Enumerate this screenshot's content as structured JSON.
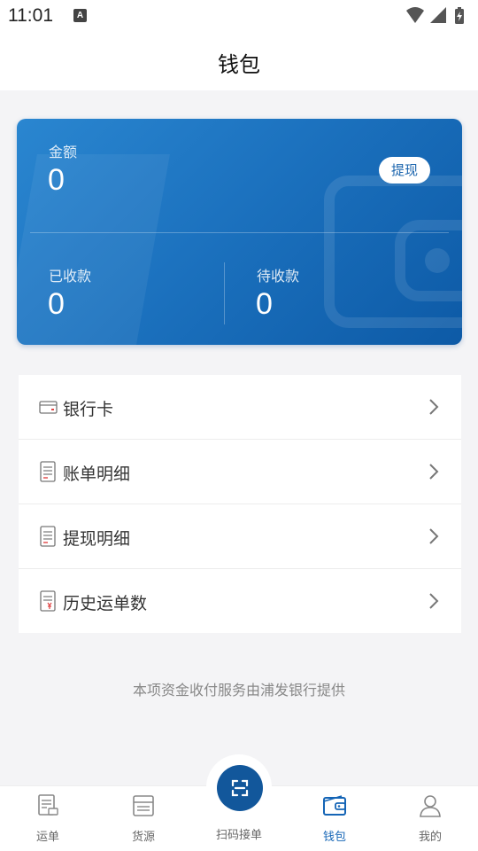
{
  "status_bar": {
    "time": "11:01",
    "notification_icon_letter": "A",
    "icons": [
      "wifi-icon",
      "signal-icon",
      "battery-charging-icon"
    ]
  },
  "header": {
    "title": "钱包"
  },
  "wallet_card": {
    "balance_label": "金额",
    "balance_value": "0",
    "withdraw_label": "提现",
    "received_label": "已收款",
    "received_value": "0",
    "pending_label": "待收款",
    "pending_value": "0",
    "gradient_colors": [
      "#2a86d0",
      "#0d5aa6"
    ]
  },
  "menu": {
    "items": [
      {
        "label": "银行卡",
        "icon": "bank-card-icon"
      },
      {
        "label": "账单明细",
        "icon": "bill-document-icon"
      },
      {
        "label": "提现明细",
        "icon": "withdraw-document-icon"
      },
      {
        "label": "历史运单数",
        "icon": "history-waybill-icon"
      }
    ]
  },
  "footer_note": "本项资金收付服务由浦发银行提供",
  "tab_bar": {
    "active_color": "#1565b6",
    "tabs": [
      {
        "label": "运单",
        "icon": "waybill-icon",
        "active": false
      },
      {
        "label": "货源",
        "icon": "cargo-icon",
        "active": false
      },
      {
        "label": "扫码接单",
        "icon": "scan-icon",
        "active": false
      },
      {
        "label": "钱包",
        "icon": "wallet-icon",
        "active": true
      },
      {
        "label": "我的",
        "icon": "profile-icon",
        "active": false
      }
    ]
  }
}
